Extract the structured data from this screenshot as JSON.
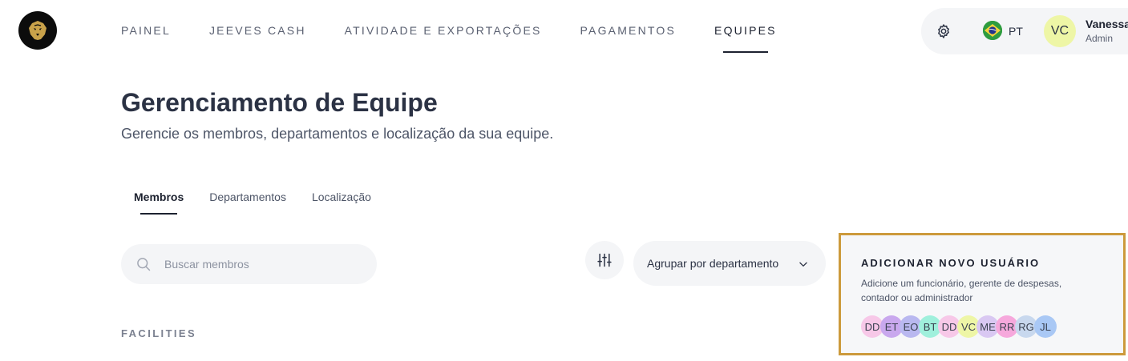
{
  "nav": {
    "items": [
      {
        "label": "PAINEL",
        "active": false
      },
      {
        "label": "JEEVES CASH",
        "active": false
      },
      {
        "label": "ATIVIDADE E EXPORTAÇÕES",
        "active": false
      },
      {
        "label": "PAGAMENTOS",
        "active": false
      },
      {
        "label": "EQUIPES",
        "active": true
      }
    ]
  },
  "user": {
    "language": "PT",
    "initials": "VC",
    "name": "Vanessa",
    "role": "Admin",
    "avatar_color": "#eef6a6"
  },
  "page": {
    "title": "Gerenciamento de Equipe",
    "subtitle": "Gerencie os membros, departamentos e localização da sua equipe."
  },
  "tabs": [
    {
      "label": "Membros",
      "active": true
    },
    {
      "label": "Departamentos",
      "active": false
    },
    {
      "label": "Localização",
      "active": false
    }
  ],
  "search": {
    "placeholder": "Buscar membros",
    "value": ""
  },
  "group_by": {
    "selected": "Agrupar por departamento"
  },
  "section": {
    "heading": "FACILITIES"
  },
  "add_user": {
    "title": "ADICIONAR NOVO USUÁRIO",
    "description": "Adicione um funcionário, gerente de despesas, contador ou administrador",
    "border_color": "#cc9a3c",
    "avatars": [
      {
        "initials": "DD",
        "color": "#f7c8e8"
      },
      {
        "initials": "ET",
        "color": "#c9a8ee"
      },
      {
        "initials": "EO",
        "color": "#b9b8f0"
      },
      {
        "initials": "BT",
        "color": "#9ff0dc"
      },
      {
        "initials": "DD",
        "color": "#f7c8e8"
      },
      {
        "initials": "VC",
        "color": "#eef6a6"
      },
      {
        "initials": "ME",
        "color": "#d9c8f2"
      },
      {
        "initials": "RR",
        "color": "#f6a8dc"
      },
      {
        "initials": "RG",
        "color": "#c8d8ee"
      },
      {
        "initials": "JL",
        "color": "#a9c8f5"
      }
    ]
  },
  "colors": {
    "accent_text": "#1d2230",
    "pill_bg": "#f4f5f7"
  }
}
